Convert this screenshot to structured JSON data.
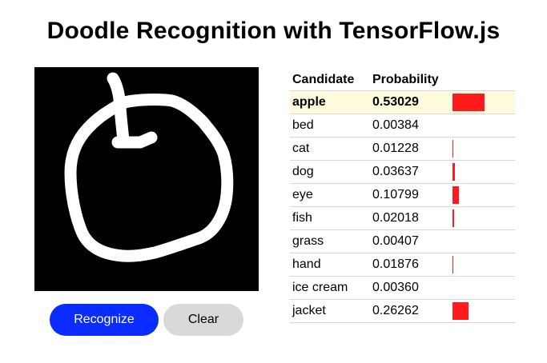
{
  "app": {
    "title": "Doodle Recognition with TensorFlow.js"
  },
  "buttons": {
    "recognize_label": "Recognize",
    "clear_label": "Clear"
  },
  "colors": {
    "accent": "#0a2cff",
    "bar": "#ff1b1b",
    "highlight_row": "#fffbdc"
  },
  "table": {
    "headers": {
      "candidate": "Candidate",
      "probability": "Probability"
    },
    "rows": [
      {
        "candidate": "apple",
        "probability": "0.53029",
        "value": 0.53029,
        "top": true
      },
      {
        "candidate": "bed",
        "probability": "0.00384",
        "value": 0.00384
      },
      {
        "candidate": "cat",
        "probability": "0.01228",
        "value": 0.01228
      },
      {
        "candidate": "dog",
        "probability": "0.03637",
        "value": 0.03637
      },
      {
        "candidate": "eye",
        "probability": "0.10799",
        "value": 0.10799
      },
      {
        "candidate": "fish",
        "probability": "0.02018",
        "value": 0.02018
      },
      {
        "candidate": "grass",
        "probability": "0.00407",
        "value": 0.00407
      },
      {
        "candidate": "hand",
        "probability": "0.01876",
        "value": 0.01876
      },
      {
        "candidate": "ice cream",
        "probability": "0.00360",
        "value": 0.0036
      },
      {
        "candidate": "jacket",
        "probability": "0.26262",
        "value": 0.26262
      }
    ]
  }
}
